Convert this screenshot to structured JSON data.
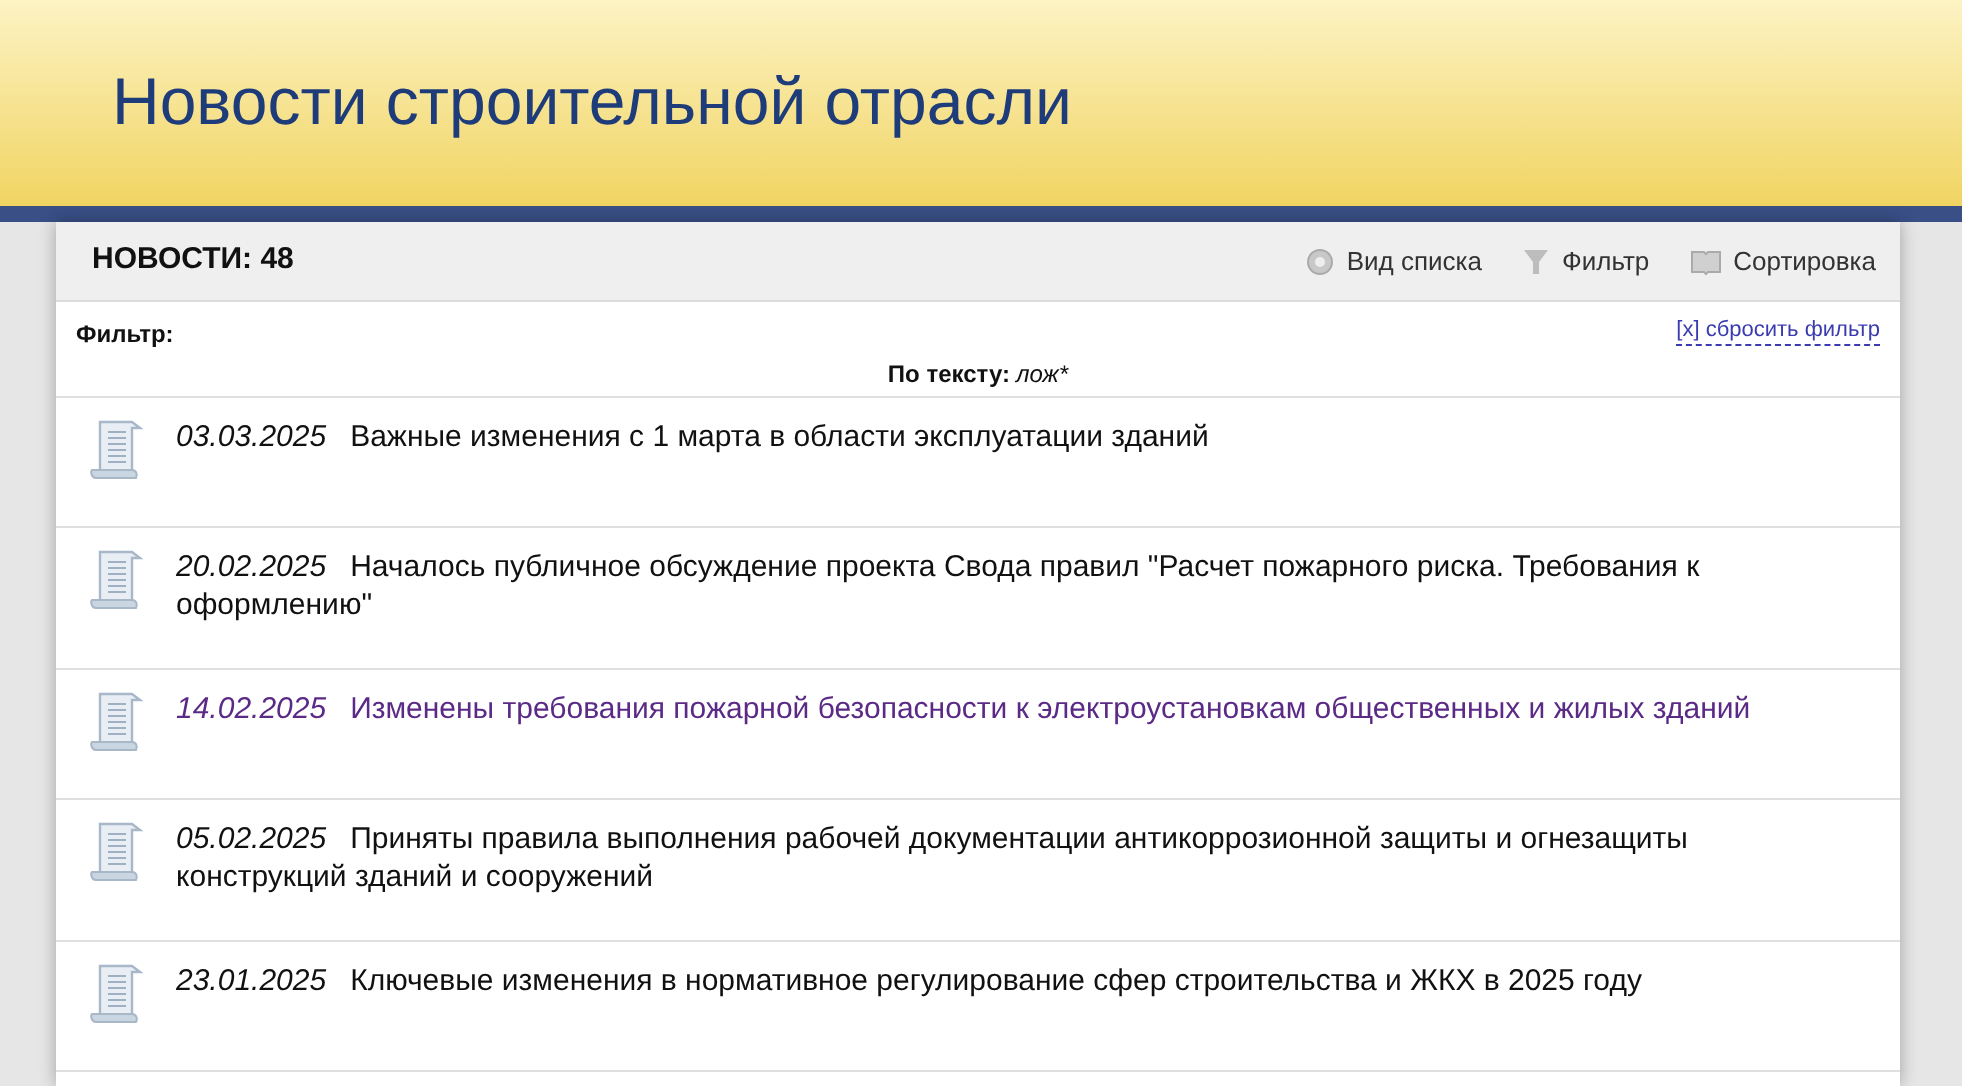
{
  "header": {
    "title": "Новости строительной отрасли"
  },
  "toolbar": {
    "count_label": "НОВОСТИ: 48",
    "actions": [
      {
        "kind": "view",
        "label": "Вид списка"
      },
      {
        "kind": "filter",
        "label": "Фильтр"
      },
      {
        "kind": "sort",
        "label": "Сортировка"
      }
    ]
  },
  "filter": {
    "label": "Фильтр:",
    "reset": "[x] сбросить фильтр",
    "criterion_label": "По тексту:",
    "criterion_value": "лож*"
  },
  "news": [
    {
      "date": "03.03.2025",
      "title": "Важные изменения с 1 марта в области эксплуатации зданий",
      "visited": false
    },
    {
      "date": "20.02.2025",
      "title": "Началось публичное обсуждение проекта Свода правил \"Расчет пожарного риска. Требования к оформлению\"",
      "visited": false
    },
    {
      "date": "14.02.2025",
      "title": "Изменены требования пожарной безопасности к электроустановкам общественных и жилых зданий",
      "visited": true
    },
    {
      "date": "05.02.2025",
      "title": "Приняты правила выполнения рабочей документации антикоррозионной защиты и огнезащиты конструкций зданий и сооружений",
      "visited": false
    },
    {
      "date": "23.01.2025",
      "title": "Ключевые изменения в нормативное регулирование сфер строительства и ЖКХ в 2025 году",
      "visited": false
    }
  ]
}
